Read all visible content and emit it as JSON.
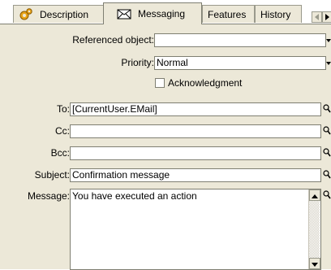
{
  "tabs": [
    {
      "label": "Description",
      "icon": "gears-icon",
      "active": false
    },
    {
      "label": "Messaging",
      "icon": "envelope-icon",
      "active": true
    },
    {
      "label": "Features",
      "active": false
    },
    {
      "label": "History",
      "active": false
    }
  ],
  "form": {
    "referenced_object_label": "Referenced object:",
    "referenced_object_value": "",
    "priority_label": "Priority:",
    "priority_value": "Normal",
    "acknowledgment_label": "Acknowledgment",
    "acknowledgment_checked": false,
    "to_label": "To:",
    "to_value": "[CurrentUser.EMail]",
    "cc_label": "Cc:",
    "cc_value": "",
    "bcc_label": "Bcc:",
    "bcc_value": "",
    "subject_label": "Subject:",
    "subject_value": "Confirmation message",
    "message_label": "Message:",
    "message_value": "You have executed an action"
  },
  "colors": {
    "panel_bg": "#ece8d8",
    "icon_orange": "#e8a317"
  }
}
